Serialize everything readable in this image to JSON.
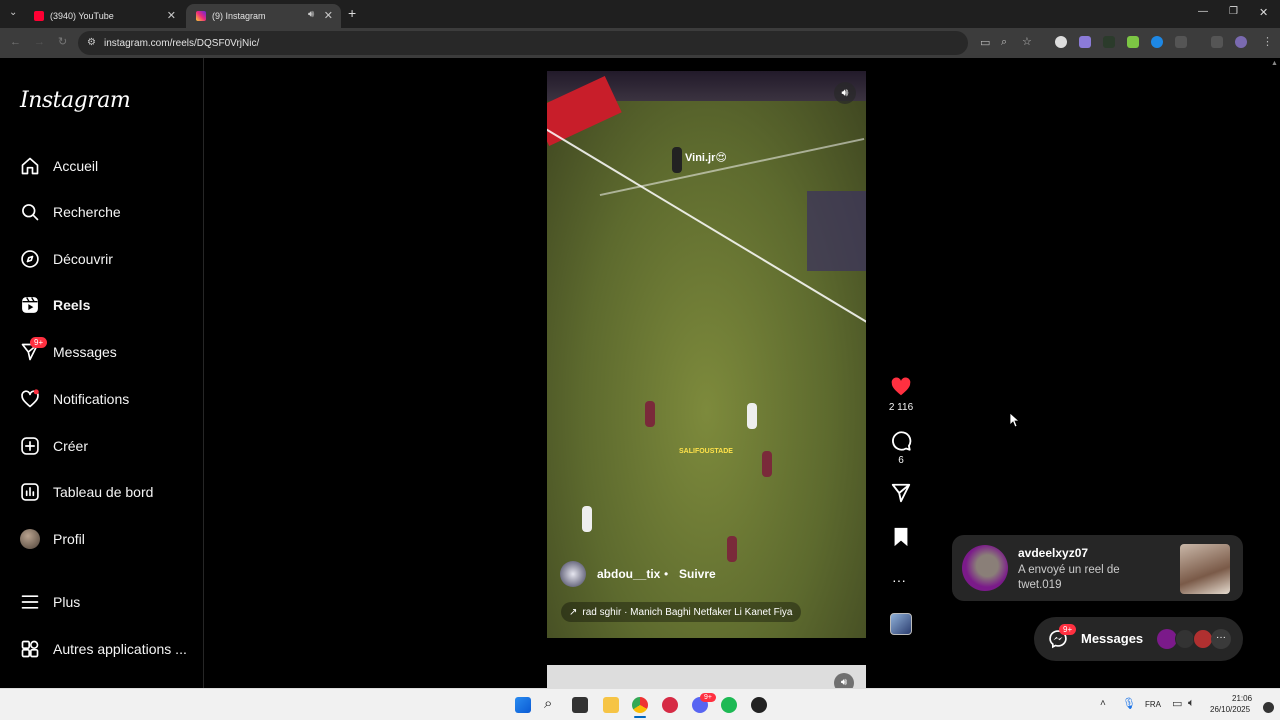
{
  "browser": {
    "tabs": [
      {
        "title": "(3940) YouTube",
        "icon": "youtube-icon"
      },
      {
        "title": "(9) Instagram",
        "icon": "instagram-icon"
      }
    ],
    "new_tab": "+",
    "url": "instagram.com/reels/DQSF0VrjNic/"
  },
  "sidebar": {
    "logo": "Instagram",
    "items": [
      {
        "label": "Accueil",
        "icon": "home-icon"
      },
      {
        "label": "Recherche",
        "icon": "search-icon"
      },
      {
        "label": "Découvrir",
        "icon": "compass-icon"
      },
      {
        "label": "Reels",
        "icon": "reels-icon"
      },
      {
        "label": "Messages",
        "icon": "messenger-icon",
        "badge": "9+"
      },
      {
        "label": "Notifications",
        "icon": "heart-icon"
      },
      {
        "label": "Créer",
        "icon": "plus-square-icon"
      },
      {
        "label": "Tableau de bord",
        "icon": "dashboard-icon"
      },
      {
        "label": "Profil",
        "icon": "avatar"
      },
      {
        "label": "Plus",
        "icon": "menu-icon"
      },
      {
        "label": "Autres applications ...",
        "icon": "apps-icon"
      }
    ]
  },
  "reel": {
    "overlay_text": "Vini.jr😍",
    "watermark": "SALIFOUSTADE",
    "username": "abdou__tix",
    "separator": "•",
    "follow": "Suivre",
    "audio": "rad sghir · Manich Baghi Netfaker Li Kanet Fiya",
    "likes": "2 116",
    "comments": "6"
  },
  "toast": {
    "user": "avdeelxyz07",
    "message_line1": "A envoyé un reel de",
    "message_line2": "twet.019"
  },
  "messages_bar": {
    "label": "Messages",
    "badge": "9+"
  },
  "taskbar": {
    "lang": "FRA",
    "time": "21:06",
    "date": "26/10/2025",
    "discord_badge": "9+"
  },
  "colors": {
    "like": "#ff3040",
    "badge": "#ff3040",
    "bg": "#000000"
  }
}
